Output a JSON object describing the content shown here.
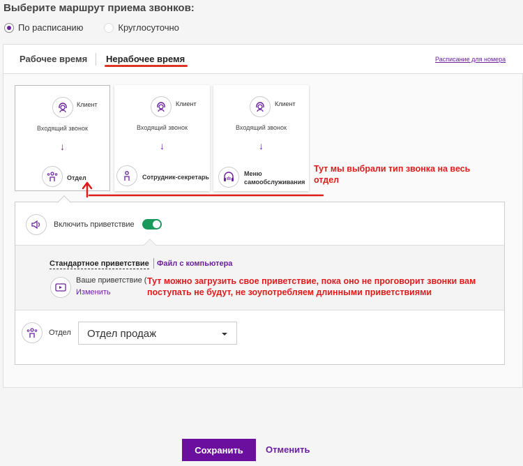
{
  "title": "Выберите маршрут приема звонков:",
  "routing": {
    "option_schedule": "По расписанию",
    "option_always": "Круглосуточно"
  },
  "tabs": {
    "work": "Рабочее время",
    "nonwork": "Нерабочее время",
    "schedule_link": "Расписание для номера"
  },
  "cards": [
    {
      "client": "Клиент",
      "incoming": "Входящий звонок",
      "arrow": "↓",
      "dest": "Отдел"
    },
    {
      "client": "Клиент",
      "incoming": "Входящий звонок",
      "arrow": "↓",
      "dest": "Сотрудник-секретарь"
    },
    {
      "client": "Клиент",
      "incoming": "Входящий звонок",
      "arrow": "↓",
      "dest_line1": "Меню",
      "dest_line2": "самообслуживания"
    }
  ],
  "greeting": {
    "toggle_label": "Включить приветствие",
    "tab_standard": "Стандартное приветствие",
    "tab_file": "Файл с компьютера",
    "your_greeting": "Ваше приветствие (",
    "change_link": "Изменить"
  },
  "department": {
    "label": "Отдел",
    "selected": "Отдел продаж"
  },
  "buttons": {
    "save": "Сохранить",
    "cancel": "Отменить"
  },
  "annotations": {
    "a1_line1": "Тут мы выбрали тип звонка на весь",
    "a1_line2": "отдел",
    "a2_line1": "Тут можно загрузить свое приветствие, пока оно не проговорит звонки вам",
    "a2_line2": "поступать не будут, не зоупотребляем длинными приветствиями"
  },
  "colors": {
    "accent": "#6a0f9e",
    "toggle_on": "#1a9a5a",
    "annotation": "#e01b1b"
  }
}
